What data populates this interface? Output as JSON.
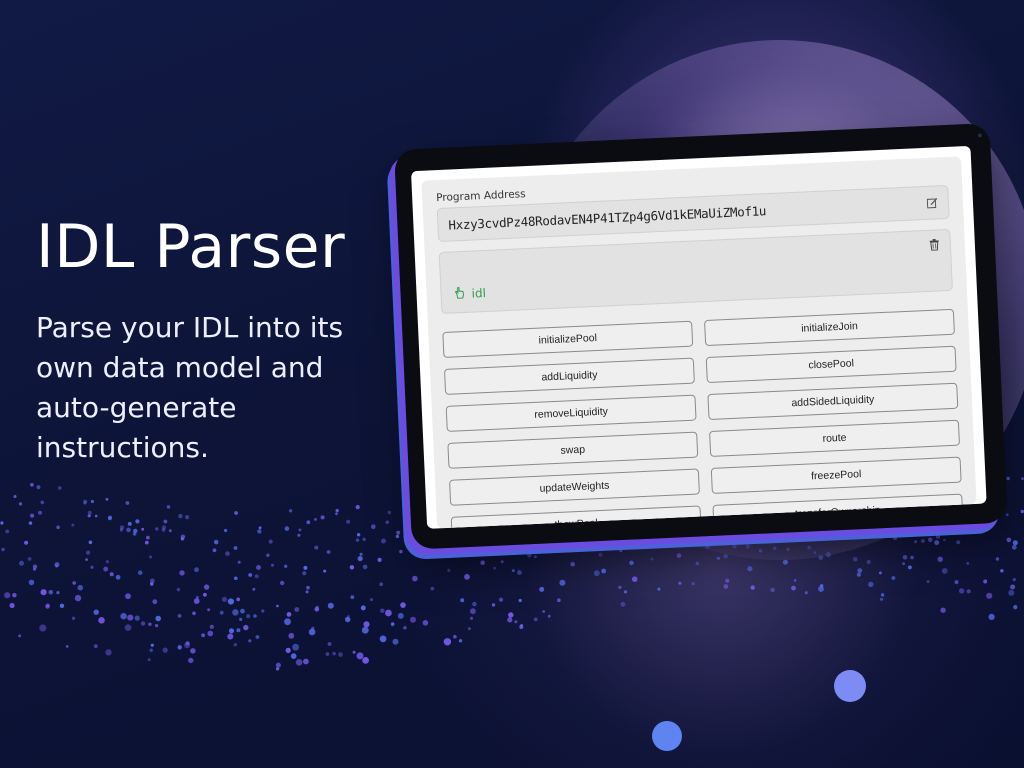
{
  "hero": {
    "title": "IDL Parser",
    "subtitle": "Parse your IDL into its own data model and auto-generate instructions."
  },
  "app": {
    "program_address_label": "Program Address",
    "program_address_value": "Hxzy3cvdPz48RodavEN4P41TZp4g6Vd1kEMaUiZMof1u",
    "idl_tag_label": "idl",
    "icons": {
      "edit": "edit-icon",
      "trash": "trash-icon",
      "idl_file": "hand-pointer-icon"
    },
    "instructions": [
      "initializePool",
      "initializeJoin",
      "addLiquidity",
      "closePool",
      "removeLiquidity",
      "addSidedLiquidity",
      "swap",
      "route",
      "updateWeights",
      "freezePool",
      "thawPool",
      "transferOwnership"
    ]
  },
  "colors": {
    "background": "#0e1436",
    "accent_purple": "#6a4de0",
    "idl_green": "#2f9e52"
  }
}
